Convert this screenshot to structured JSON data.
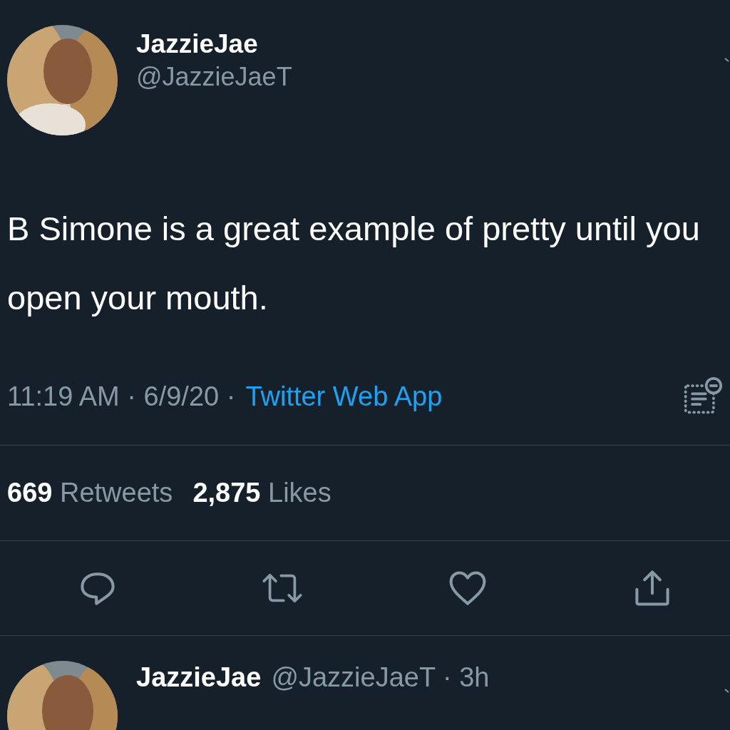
{
  "tweet": {
    "author": {
      "name": "JazzieJae",
      "handle": "@JazzieJaeT"
    },
    "text": "B Simone is a great example of pretty until you open your mouth.",
    "meta": [
      {
        "kind": "plain",
        "text": "11:19 AM · 6/9/20 ·"
      },
      {
        "kind": "link",
        "text": "Twitter Web App"
      }
    ],
    "stats": [
      {
        "count": "669",
        "label": "Retweets"
      },
      {
        "count": "2,875",
        "label": "Likes"
      }
    ],
    "actions": [
      {
        "kind": "reply"
      },
      {
        "kind": "retweet"
      },
      {
        "kind": "like"
      },
      {
        "kind": "share"
      }
    ]
  },
  "reply": {
    "name": "JazzieJae",
    "handle_time": "@JazzieJaeT · 3h"
  }
}
